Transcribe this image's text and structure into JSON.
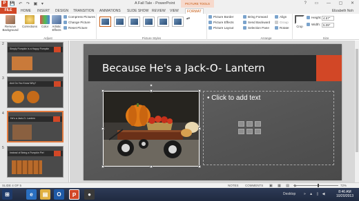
{
  "window": {
    "title": "A Fall Tale - PowerPoint",
    "context_group": "PICTURE TOOLS",
    "app_icon_letter": "P"
  },
  "tabs": [
    {
      "label": "FILE"
    },
    {
      "label": "HOME"
    },
    {
      "label": "INSERT"
    },
    {
      "label": "DESIGN"
    },
    {
      "label": "TRANSITION"
    },
    {
      "label": "ANIMATIONS"
    },
    {
      "label": "SLIDE SHOW"
    },
    {
      "label": "REVIEW"
    },
    {
      "label": "VIEW"
    },
    {
      "label": "FORMAT"
    }
  ],
  "user": "Elizabeth Noh",
  "ribbon": {
    "remove_background": "Remove Background",
    "corrections": "Corrections",
    "color": "Color",
    "artistic_effects": "Artistic Effects",
    "compress": "Compress Pictures",
    "change": "Change Picture",
    "reset": "Reset Picture",
    "adjust_label": "Adjust",
    "picture_styles_label": "Picture Styles",
    "picture_border": "Picture Border",
    "picture_effects": "Picture Effects",
    "picture_layout": "Picture Layout",
    "bring_forward": "Bring Forward",
    "send_backward": "Send Backward",
    "selection_pane": "Selection Pane",
    "align": "Align",
    "group": "Group",
    "rotate": "Rotate",
    "arrange_label": "Arrange",
    "crop": "Crop",
    "height_label": "Height:",
    "height_value": "4.57\"",
    "width_label": "Width:",
    "width_value": "5.09\"",
    "size_label": "Size"
  },
  "slides": [
    {
      "num": "2",
      "title": "Simply Pumpkin is a Happy Pumpkin"
    },
    {
      "num": "3",
      "title": "And Do You Know Why?"
    },
    {
      "num": "4",
      "title": "He's a Jack-O- Lantern"
    },
    {
      "num": "5",
      "title": "Instead of Being a Pumpkin Pie!"
    }
  ],
  "current_slide": {
    "title": "Because He's a Jack-O- Lantern",
    "placeholder": "Click to add text"
  },
  "status": {
    "slide_of": "SLIDE 4 OF 5",
    "notes": "NOTES",
    "comments": "COMMENTS",
    "zoom": "72%"
  },
  "taskbar": {
    "desktop": "Desktop",
    "time": "8:46 AM",
    "date": "10/20/2013"
  },
  "colors": {
    "accent": "#d24726",
    "title_bar": "#2b2b2b",
    "slide_bg": "#5a5a5a"
  }
}
